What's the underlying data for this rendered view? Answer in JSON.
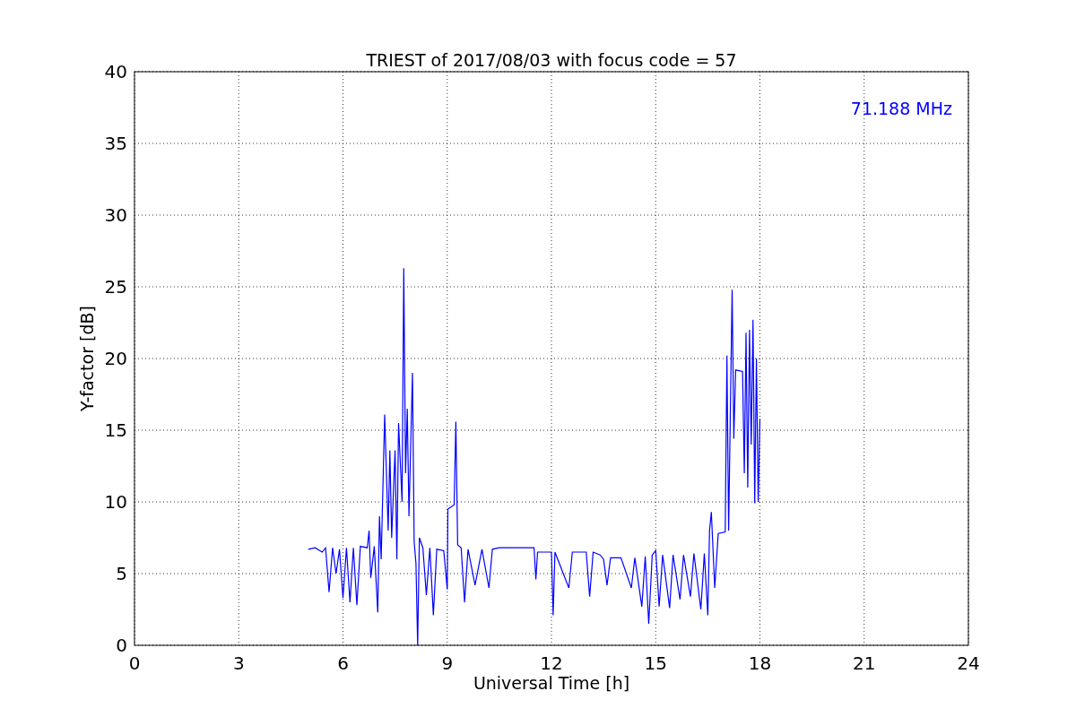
{
  "chart_data": {
    "type": "line",
    "title": "TRIEST of 2017/08/03 with focus code = 57",
    "xlabel": "Universal Time [h]",
    "ylabel": "Y-factor [dB]",
    "x": [
      5.0,
      5.2,
      5.4,
      5.5,
      5.6,
      5.7,
      5.8,
      5.9,
      6.0,
      6.1,
      6.2,
      6.3,
      6.4,
      6.5,
      6.7,
      6.75,
      6.8,
      6.9,
      7.0,
      7.05,
      7.1,
      7.2,
      7.3,
      7.35,
      7.4,
      7.5,
      7.55,
      7.6,
      7.7,
      7.75,
      7.8,
      7.85,
      7.9,
      8.0,
      8.05,
      8.1,
      8.15,
      8.2,
      8.3,
      8.4,
      8.5,
      8.6,
      8.7,
      8.9,
      9.0,
      9.02,
      9.2,
      9.25,
      9.3,
      9.4,
      9.5,
      9.6,
      9.8,
      10.0,
      10.2,
      10.3,
      10.5,
      11.5,
      11.55,
      11.6,
      12.0,
      12.05,
      12.1,
      12.5,
      12.6,
      13.0,
      13.1,
      13.2,
      13.4,
      13.5,
      13.6,
      13.7,
      14.0,
      14.3,
      14.4,
      14.6,
      14.7,
      14.8,
      14.9,
      15.0,
      15.1,
      15.2,
      15.4,
      15.5,
      15.7,
      15.8,
      16.0,
      16.1,
      16.3,
      16.4,
      16.5,
      16.55,
      16.6,
      16.7,
      16.8,
      17.0,
      17.05,
      17.1,
      17.2,
      17.25,
      17.3,
      17.5,
      17.55,
      17.6,
      17.65,
      17.7,
      17.75,
      17.8,
      17.85,
      17.9,
      17.95,
      18.0
    ],
    "series": [
      {
        "color": "#0000ff",
        "values": [
          6.7,
          6.8,
          6.5,
          6.8,
          3.7,
          6.8,
          5.0,
          6.7,
          3.3,
          6.8,
          3.0,
          6.8,
          2.8,
          6.9,
          6.8,
          8.0,
          4.7,
          6.9,
          2.3,
          9.0,
          6.0,
          16.1,
          8.0,
          13.6,
          7.5,
          13.6,
          6.0,
          15.5,
          10.0,
          26.3,
          12.0,
          16.5,
          9.0,
          19.0,
          7.2,
          5.7,
          0.0,
          7.5,
          6.8,
          3.5,
          6.8,
          2.1,
          6.7,
          6.6,
          3.9,
          9.5,
          9.8,
          15.6,
          7.0,
          6.8,
          3.0,
          6.7,
          4.2,
          6.7,
          4.0,
          6.7,
          6.8,
          6.8,
          4.6,
          6.5,
          6.5,
          2.1,
          6.5,
          4.0,
          6.5,
          6.5,
          3.4,
          6.5,
          6.3,
          6.0,
          4.2,
          6.1,
          6.1,
          4.0,
          6.1,
          2.7,
          6.2,
          1.5,
          6.3,
          6.6,
          2.7,
          6.3,
          2.6,
          6.3,
          3.2,
          6.3,
          3.4,
          6.4,
          2.5,
          6.4,
          2.1,
          8.0,
          9.3,
          4.0,
          7.8,
          7.9,
          20.2,
          8.0,
          24.8,
          14.4,
          19.2,
          19.1,
          12.0,
          21.8,
          11.0,
          22.0,
          14.0,
          22.7,
          9.9,
          20.0,
          10.0,
          15.8
        ]
      }
    ],
    "xlim": [
      0,
      24
    ],
    "ylim": [
      0,
      40
    ],
    "xticks": [
      0,
      3,
      6,
      9,
      12,
      15,
      18,
      21,
      24
    ],
    "yticks": [
      0,
      5,
      10,
      15,
      20,
      25,
      30,
      35,
      40
    ],
    "grid": true,
    "annotations": [
      "71.188 MHz"
    ]
  }
}
